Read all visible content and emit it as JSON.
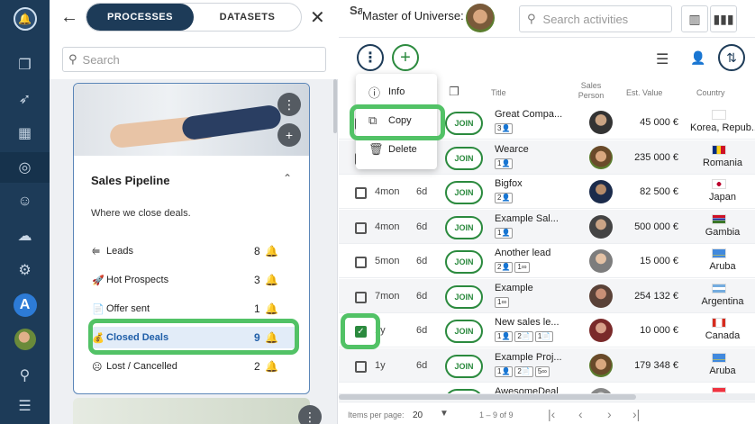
{
  "panel": {
    "tabs": [
      "PROCESSES",
      "DATASETS"
    ],
    "search_placeholder": "Search",
    "card": {
      "title": "Sales Pipeline",
      "description": "Where we close deals.",
      "stages": [
        {
          "label": "Leads",
          "count": "8",
          "icon": "⥢"
        },
        {
          "label": "Hot Prospects",
          "count": "3",
          "icon": "🚀"
        },
        {
          "label": "Offer sent",
          "count": "1",
          "icon": "📄"
        },
        {
          "label": "Closed Deals",
          "count": "9",
          "icon": "💰"
        },
        {
          "label": "Lost / Cancelled",
          "count": "2",
          "icon": "☹"
        }
      ]
    }
  },
  "topbar": {
    "title": "Sa",
    "owner": "Master of Universe:",
    "search_placeholder": "Search activities"
  },
  "menu": {
    "info": "Info",
    "copy": "Copy",
    "delete": "Delete"
  },
  "table": {
    "headers": {
      "title": "Title",
      "sales_person": "Sales Person",
      "est_value": "Est. Value",
      "country": "Country"
    },
    "join_label": "JOIN",
    "rows": [
      {
        "age": "",
        "days": "",
        "title": "Great Compa...",
        "tags": [
          "3👤"
        ],
        "value": "45 000 €",
        "country": "Korea, Repub...",
        "flag": "kr",
        "checked": false
      },
      {
        "age": "",
        "days": "",
        "title": "Wearce",
        "tags": [
          "1👤"
        ],
        "value": "235 000 €",
        "country": "Romania",
        "flag": "ro",
        "checked": false
      },
      {
        "age": "4mon",
        "days": "6d",
        "title": "Bigfox",
        "tags": [
          "2👤"
        ],
        "value": "82 500 €",
        "country": "Japan",
        "flag": "jp",
        "checked": false
      },
      {
        "age": "4mon",
        "days": "6d",
        "title": "Example Sal...",
        "tags": [
          "1👤"
        ],
        "value": "500 000 €",
        "country": "Gambia",
        "flag": "gm",
        "checked": false
      },
      {
        "age": "5mon",
        "days": "6d",
        "title": "Another lead",
        "tags": [
          "2👤",
          "1∞"
        ],
        "value": "15 000 €",
        "country": "Aruba",
        "flag": "aw",
        "checked": false
      },
      {
        "age": "7mon",
        "days": "6d",
        "title": "Example",
        "tags": [
          "1∞"
        ],
        "value": "254 132 €",
        "country": "Argentina",
        "flag": "ar",
        "checked": false
      },
      {
        "age": "1y",
        "days": "6d",
        "title": "New sales le...",
        "tags": [
          "1👤",
          "2📄",
          "1📄"
        ],
        "value": "10 000 €",
        "country": "Canada",
        "flag": "ca",
        "checked": true
      },
      {
        "age": "1y",
        "days": "6d",
        "title": "Example Proj...",
        "tags": [
          "1👤",
          "2📄",
          "5∞"
        ],
        "value": "179 348 €",
        "country": "Aruba",
        "flag": "aw",
        "checked": false
      },
      {
        "age": "",
        "days": "",
        "title": "AwesomeDeal",
        "tags": [],
        "value": "",
        "country": "",
        "flag": "sg",
        "checked": false
      }
    ]
  },
  "footer": {
    "items_label": "Items per page:",
    "per_page": "20",
    "range": "1 – 9 of 9"
  },
  "colors": {
    "nav": "#1d3b58",
    "accent_green": "#2b8a3e",
    "highlight": "#52c266"
  }
}
